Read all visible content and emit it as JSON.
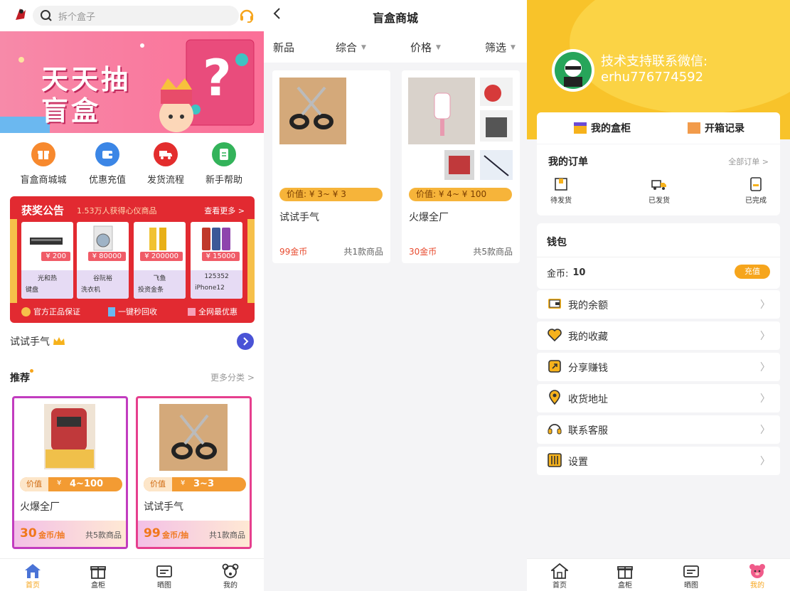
{
  "home": {
    "search_placeholder": "拆个盒子",
    "banner_text": "天天抽盲盒",
    "quick": [
      {
        "label": "盲盒商城城",
        "icon": "gift-icon"
      },
      {
        "label": "优惠充值",
        "icon": "wallet-icon"
      },
      {
        "label": "发货流程",
        "icon": "truck-icon"
      },
      {
        "label": "新手帮助",
        "icon": "document-icon"
      }
    ],
    "prize": {
      "title": "获奖公告",
      "subtitle": "1.53万人获得心仪商品",
      "more": "查看更多 >",
      "items": [
        {
          "price": "¥ 200",
          "user": "光和热",
          "name": "键盘"
        },
        {
          "price": "¥ 80000",
          "user": "谷阮裕",
          "name": "洗衣机"
        },
        {
          "price": "¥ 200000",
          "user": "飞鱼",
          "name": "投资金条"
        },
        {
          "price": "¥ 15000",
          "user": "125352",
          "name": "iPhone12"
        }
      ],
      "features": [
        "官方正品保证",
        "一键秒回收",
        "全网最优惠"
      ]
    },
    "trial": "试试手气",
    "reco_title": "推荐",
    "reco_more": "更多分类 >",
    "reco_cards": [
      {
        "value_label": "价值",
        "value": "4~100",
        "currency": "¥",
        "name": "火爆全厂",
        "price_num": "30",
        "price_unit": "金币/抽",
        "count": "共5款商品",
        "border": "#c23cbf"
      },
      {
        "value_label": "价值",
        "value": "3~3",
        "currency": "¥",
        "name": "试试手气",
        "price_num": "99",
        "price_unit": "金币/抽",
        "count": "共1款商品",
        "border": "#e63f8e"
      }
    ]
  },
  "tabbar": [
    {
      "label": "首页",
      "icon": "home-icon"
    },
    {
      "label": "盒柜",
      "icon": "gift-box-icon"
    },
    {
      "label": "晒图",
      "icon": "ticket-icon"
    },
    {
      "label": "我的",
      "icon": "bear-icon"
    }
  ],
  "shop": {
    "title": "盲盒商城",
    "filters": [
      "新品",
      "综合",
      "价格",
      "筛选"
    ],
    "cards": [
      {
        "value": "价值: ¥ 3~ ¥ 3",
        "name": "试试手气",
        "price": "99金币",
        "count": "共1款商品"
      },
      {
        "value": "价值: ¥ 4~ ¥ 100",
        "name": "火爆全厂",
        "price": "30金币",
        "count": "共5款商品"
      }
    ]
  },
  "profile": {
    "contact_line1": "技术支持联系微信:",
    "contact_line2": "erhu776774592",
    "cabinet": "我的盒柜",
    "records": "开箱记录",
    "orders_title": "我的订单",
    "orders_all": "全部订单 >",
    "order_states": [
      "待发货",
      "已发货",
      "已完成"
    ],
    "wallet_title": "钱包",
    "coin_label": "金币:",
    "coin_value": "10",
    "recharge": "充值",
    "menu": [
      {
        "label": "我的余额",
        "icon": "balance-icon"
      },
      {
        "label": "我的收藏",
        "icon": "heart-icon"
      },
      {
        "label": "分享赚钱",
        "icon": "share-icon"
      },
      {
        "label": "收货地址",
        "icon": "location-icon"
      },
      {
        "label": "联系客服",
        "icon": "headset-icon"
      },
      {
        "label": "设置",
        "icon": "settings-icon"
      }
    ]
  },
  "colors": {
    "accent": "#f6a51c",
    "red": "#e22a31",
    "pink": "#fb6f97",
    "orange": "#f0932b"
  }
}
